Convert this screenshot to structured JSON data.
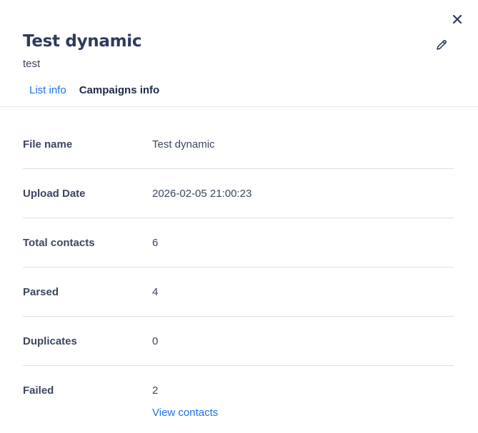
{
  "header": {
    "title": "Test dynamic",
    "subtitle": "test",
    "close_icon": "close-icon",
    "edit_icon": "pencil-icon"
  },
  "tabs": [
    {
      "label": "List info",
      "active": true
    },
    {
      "label": "Campaigns info",
      "active": false
    }
  ],
  "info": {
    "rows": [
      {
        "label": "File name",
        "value": "Test dynamic"
      },
      {
        "label": "Upload Date",
        "value": "2026-02-05 21:00:23"
      },
      {
        "label": "Total contacts",
        "value": "6"
      },
      {
        "label": "Parsed",
        "value": "4"
      },
      {
        "label": "Duplicates",
        "value": "0"
      },
      {
        "label": "Failed",
        "value": "2"
      }
    ],
    "view_contacts_link": "View contacts"
  },
  "colors": {
    "accent": "#1a73e8",
    "text": "#2b3a55",
    "divider": "#dcdfe6"
  }
}
